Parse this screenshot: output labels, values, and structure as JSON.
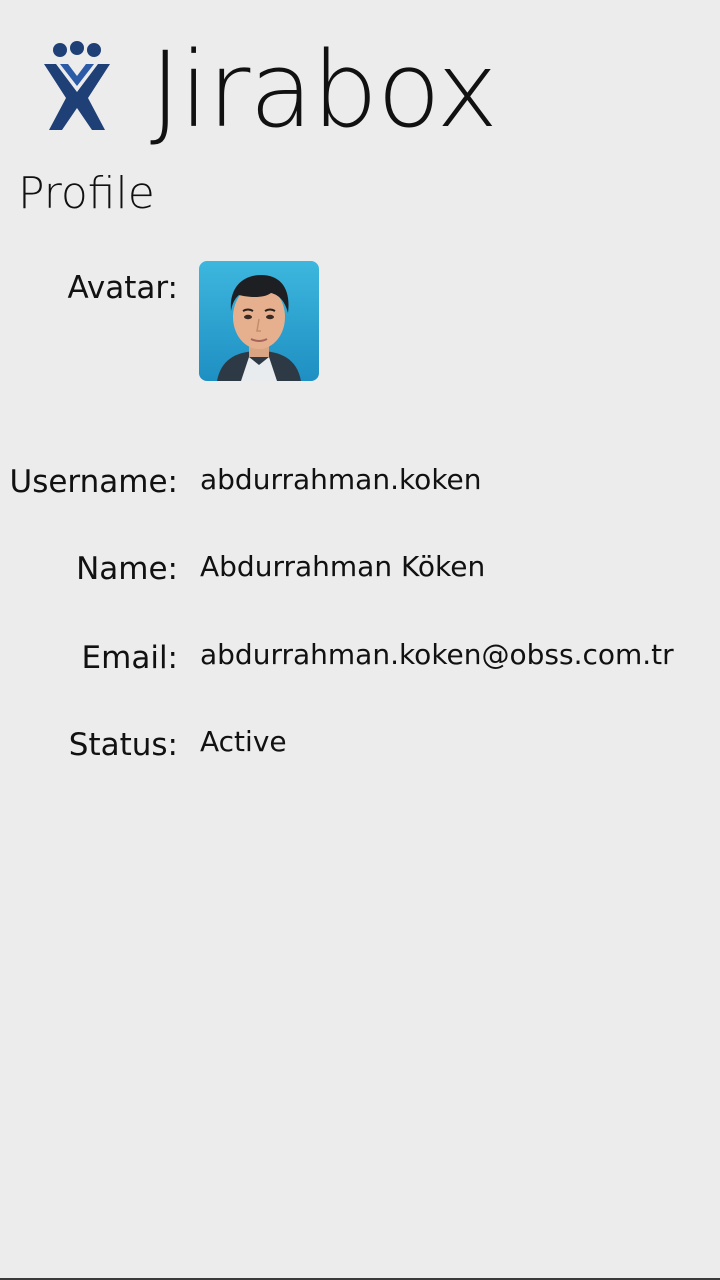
{
  "app": {
    "title": "Jirabox",
    "logo_icon": "jira-logo-icon",
    "brand_color": "#1f3f77"
  },
  "page": {
    "title": "Profile"
  },
  "profile": {
    "avatar_label": "Avatar:",
    "username_label": "Username:",
    "username_value": "abdurrahman.koken",
    "name_label": "Name:",
    "name_value": "Abdurrahman Köken",
    "email_label": "Email:",
    "email_value": "abdurrahman.koken@obss.com.tr",
    "status_label": "Status:",
    "status_value": "Active"
  },
  "theme": {
    "background": "#ececec",
    "text": "#111111"
  }
}
